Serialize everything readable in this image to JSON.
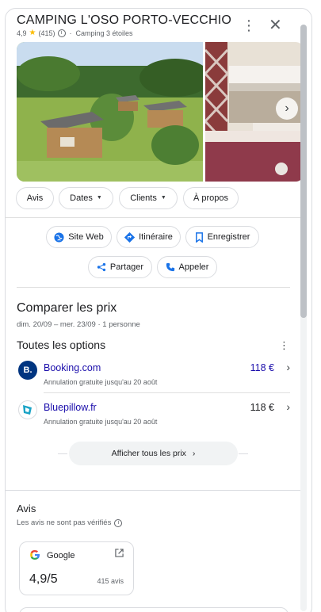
{
  "header": {
    "title": "CAMPING L'OSO PORTO-VECCHIO",
    "rating": "4,9",
    "review_count": "(415)",
    "category": "Camping 3 étoiles",
    "more_icon": "more-vert-icon",
    "close_icon": "close-icon"
  },
  "photos": {
    "main_alt": "Mobile homes on grass",
    "side_alt": "Bedroom interior",
    "next_icon": "chevron-right-icon"
  },
  "chips": [
    {
      "label": "Avis"
    },
    {
      "label": "Dates"
    },
    {
      "label": "Clients"
    },
    {
      "label": "À propos"
    }
  ],
  "actions": {
    "website": "Site Web",
    "directions": "Itinéraire",
    "save": "Enregistrer",
    "share": "Partager",
    "call": "Appeler"
  },
  "prices": {
    "title": "Comparer les prix",
    "dates": "dim. 20/09 – mer. 23/09",
    "guests": "1 personne",
    "options_title": "Toutes les options",
    "providers": [
      {
        "name": "Booking.com",
        "note": "Annulation gratuite jusqu'au 20 août",
        "price": "118 €",
        "price_color": "#1a0dab",
        "logo_color": "#003580",
        "logo_letter": "B."
      },
      {
        "name": "Bluepillow.fr",
        "note": "Annulation gratuite jusqu'au 20 août",
        "price": "118 €",
        "price_color": "#202124",
        "logo_color": "#ffffff",
        "logo_letter": ""
      }
    ],
    "show_all": "Afficher tous les prix"
  },
  "reviews": {
    "title": "Avis",
    "disclaimer": "Les avis ne sont pas vérifiés",
    "google": {
      "source": "Google",
      "score": "4,9/5",
      "count": "415 avis"
    }
  },
  "colors": {
    "accent": "#1a73e8",
    "link": "#1a0dab",
    "star": "#fbbc04"
  }
}
